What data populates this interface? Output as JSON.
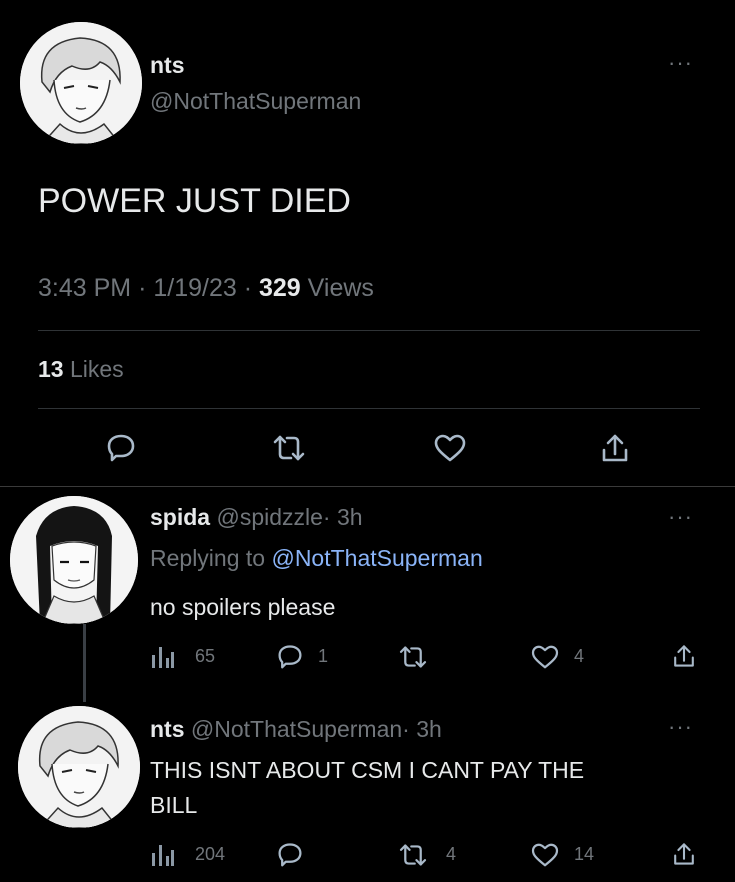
{
  "main_tweet": {
    "display_name": "nts",
    "handle": "@NotThatSuperman",
    "text": "POWER JUST DIED",
    "time": "3:43 PM",
    "date": "1/19/23",
    "views_count": "329",
    "views_label": "Views",
    "sep": "·",
    "likes_count": "13",
    "likes_label": "Likes",
    "more": "···"
  },
  "reply_1": {
    "display_name": "spida",
    "handle": "@spidzzle",
    "time": "· 3h",
    "replying_prefix": "Replying to",
    "replying_to": "@NotThatSuperman",
    "text": "no spoilers please",
    "views": "65",
    "replies": "1",
    "retweets": "",
    "likes": "4",
    "more": "···"
  },
  "reply_2": {
    "display_name": "nts",
    "handle": "@NotThatSuperman",
    "time": "· 3h",
    "text_line1": "THIS ISNT ABOUT CSM I CANT PAY THE",
    "text_line2": "BILL",
    "views": "204",
    "replies": "",
    "retweets": "4",
    "likes": "14",
    "more": "···"
  },
  "colors": {
    "background": "#000000",
    "text": "#e7e9ea",
    "secondary": "#71767b",
    "link": "#8ab4f8",
    "icon_main": "#a9b9c9"
  },
  "icons": [
    "reply-icon",
    "retweet-icon",
    "like-icon",
    "share-icon",
    "views-icon",
    "more-icon"
  ]
}
